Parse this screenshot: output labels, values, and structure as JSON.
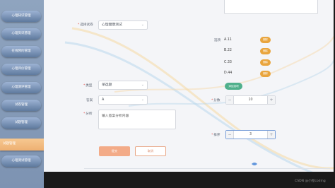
{
  "sidebar": {
    "items": [
      {
        "label": "心理知识管理"
      },
      {
        "label": "心理资讯管理"
      },
      {
        "label": "在线预约管理"
      },
      {
        "label": "心理评价管理"
      },
      {
        "label": "心理测评管理"
      },
      {
        "label": "试卷管理"
      },
      {
        "label": "试题管理"
      },
      {
        "label": "试题管理"
      },
      {
        "label": "心理测试管理"
      }
    ]
  },
  "form": {
    "paper_label": "选择试卷",
    "paper_value": "心理健康测试",
    "type_label": "类型",
    "type_value": "单选题",
    "answer_label": "答案",
    "answer_value": "A",
    "analysis_label": "分析",
    "analysis_placeholder": "输入答案分析内容",
    "options_label": "选项",
    "options": [
      {
        "text": "A.11",
        "delete_label": "删除"
      },
      {
        "text": "B.22",
        "delete_label": "删除"
      },
      {
        "text": "C.33",
        "delete_label": "删除"
      },
      {
        "text": "D.44",
        "delete_label": "删除"
      }
    ],
    "add_option_label": "添加选项",
    "score_label": "分数",
    "score_value": "10",
    "sort_label": "排序",
    "sort_value": "3",
    "submit_label": "提交",
    "cancel_label": "取消"
  },
  "watermark": "CSDN @小程coding",
  "colors": {
    "delete_button": "#e9a53e",
    "add_button": "#4fb08c",
    "submit_button": "#f3ab88",
    "sidebar_active": "#f6c891",
    "sidebar_bg": "#8fa4bf"
  }
}
